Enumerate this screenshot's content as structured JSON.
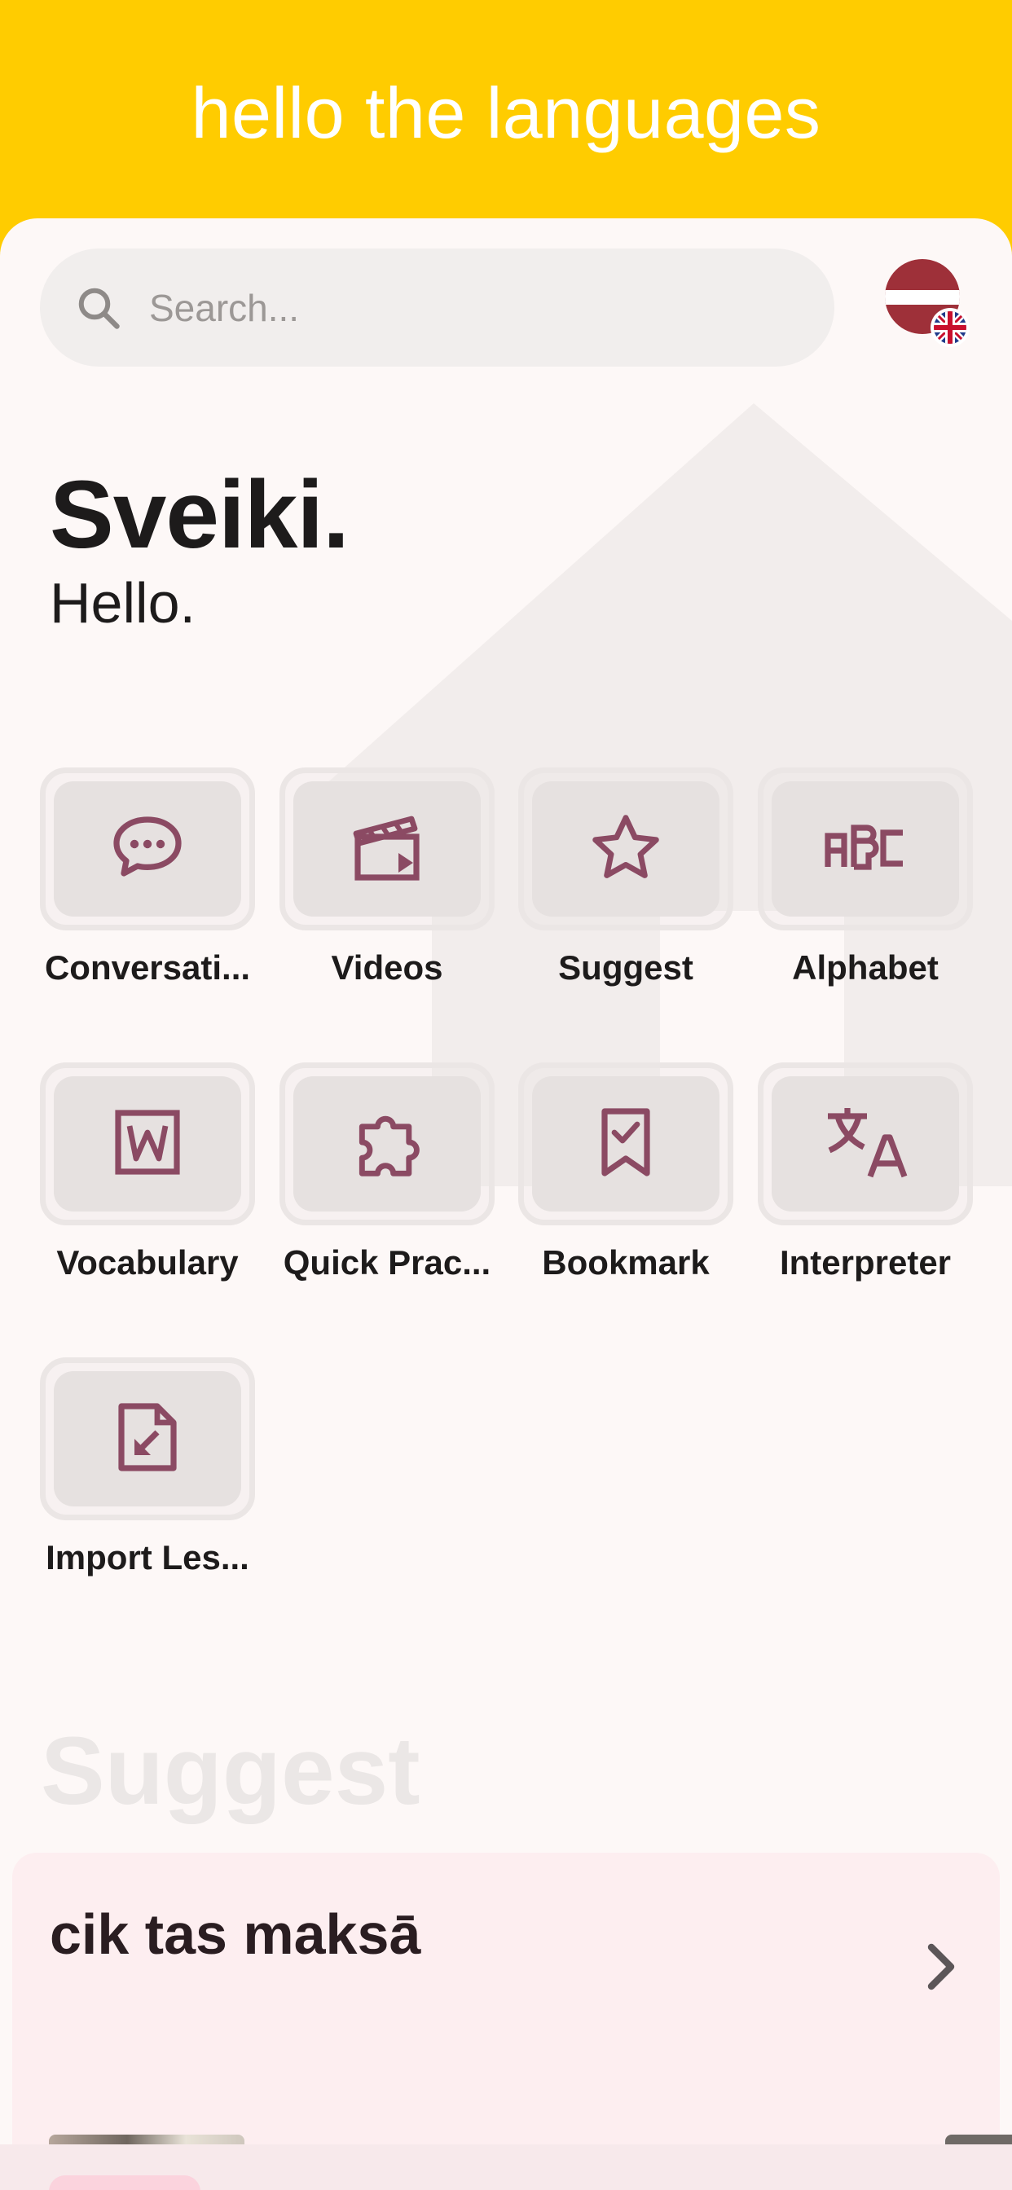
{
  "header": {
    "title": "hello the languages"
  },
  "search": {
    "placeholder": "Search..."
  },
  "language_flags": {
    "primary": "latvia-flag",
    "secondary": "uk-flag"
  },
  "greeting": {
    "title": "Sveiki.",
    "subtitle": "Hello."
  },
  "tiles": [
    {
      "label": "Conversati...",
      "icon": "chat-bubble-icon"
    },
    {
      "label": "Videos",
      "icon": "clapperboard-icon"
    },
    {
      "label": "Suggest",
      "icon": "star-icon"
    },
    {
      "label": "Alphabet",
      "icon": "abc-icon"
    },
    {
      "label": "Vocabulary",
      "icon": "word-document-icon"
    },
    {
      "label": "Quick Prac...",
      "icon": "puzzle-icon"
    },
    {
      "label": "Bookmark",
      "icon": "bookmark-check-icon"
    },
    {
      "label": "Interpreter",
      "icon": "translate-icon"
    },
    {
      "label": "Import Les...",
      "icon": "file-import-icon"
    }
  ],
  "suggest": {
    "heading": "Suggest",
    "phrase": "cik tas maksā"
  },
  "colors": {
    "accent": "#ffcc00",
    "icon": "#8b4a63",
    "text": "#1d1b1b",
    "card": "#fdeef0"
  }
}
